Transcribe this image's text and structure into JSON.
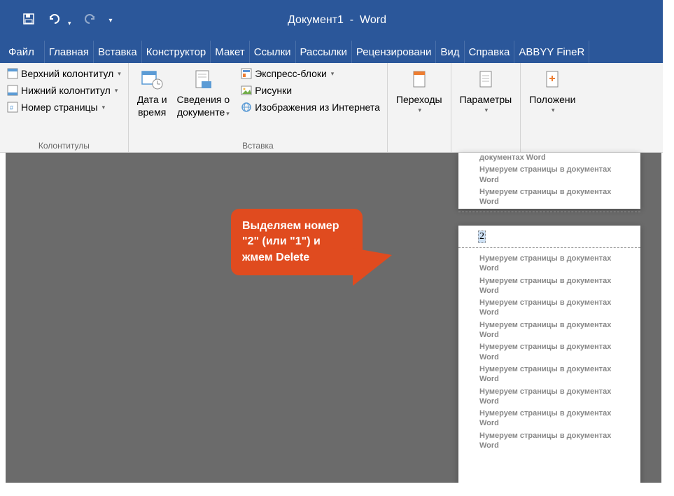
{
  "title": {
    "doc": "Документ1",
    "sep": "-",
    "app": "Word"
  },
  "tabs": [
    "Файл",
    "Главная",
    "Вставка",
    "Конструктор",
    "Макет",
    "Ссылки",
    "Рассылки",
    "Рецензировани",
    "Вид",
    "Справка",
    "ABBYY FineR"
  ],
  "groups": {
    "headers": {
      "label": "Колонтитулы",
      "top": "Верхний колонтитул",
      "bottom": "Нижний колонтитул",
      "page": "Номер страницы"
    },
    "insert": {
      "label": "Вставка",
      "datetime1": "Дата и",
      "datetime2": "время",
      "docinfo1": "Сведения о",
      "docinfo2": "документе",
      "quickparts": "Экспресс-блоки",
      "pictures": "Рисунки",
      "onlinepics": "Изображения из Интернета"
    },
    "nav": {
      "label": "Переходы"
    },
    "opts": {
      "label": "Параметры"
    },
    "pos": {
      "label": "Положени"
    }
  },
  "callout": "Выделяем номер \"2\" (или \"1\") и жмем Delete",
  "page": {
    "line": "Нумеруем страницы в документах Word",
    "num": "2",
    "cutoff": "документах Word"
  }
}
